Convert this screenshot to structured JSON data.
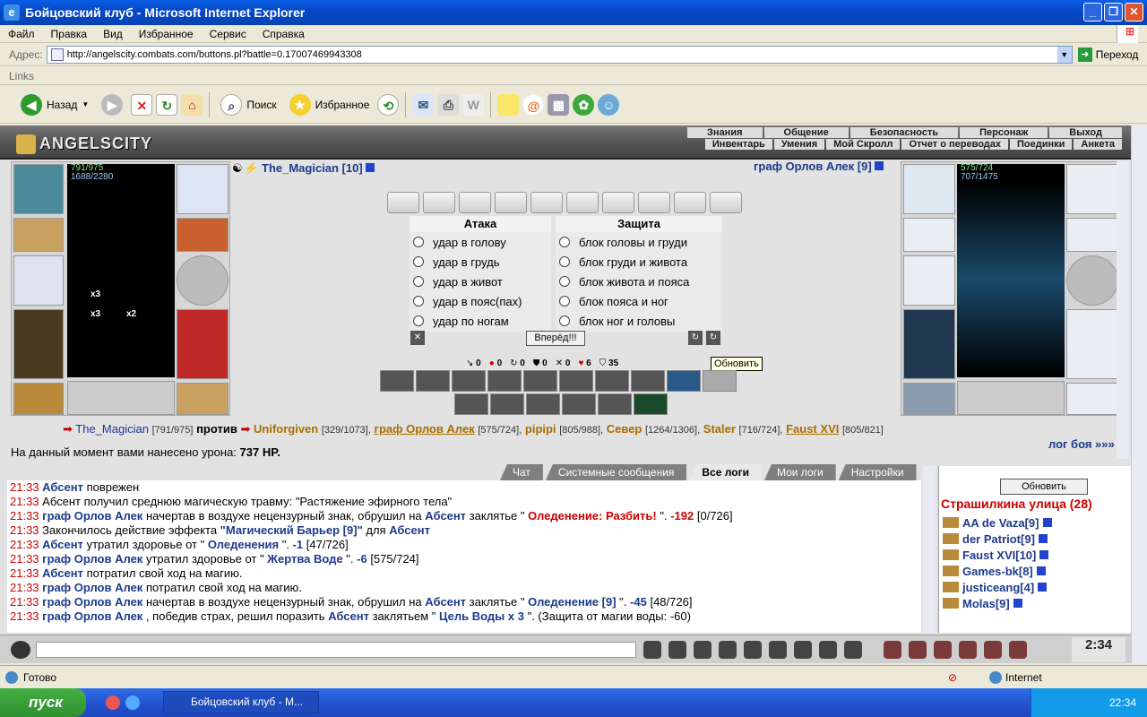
{
  "window": {
    "title": "Бойцовский клуб - Microsoft Internet Explorer"
  },
  "menu": [
    "Файл",
    "Правка",
    "Вид",
    "Избранное",
    "Сервис",
    "Справка"
  ],
  "address": {
    "label": "Адрес:",
    "url": "http://angelscity.combats.com/buttons.pl?battle=0.17007469943308",
    "go": "Переход"
  },
  "links": "Links",
  "toolbar": {
    "back": "Назад",
    "search": "Поиск",
    "favorites": "Избранное"
  },
  "site": {
    "logo": "ANGELSCITY",
    "menu_top": [
      "Знания",
      "Общение",
      "Безопасность",
      "Персонаж",
      "Выход"
    ],
    "menu_bottom": [
      "Инвентарь",
      "Умения",
      "Мой Скролл",
      "Отчет о переводах",
      "Поединки",
      "Анкета"
    ]
  },
  "player": {
    "name": "The_Magician [10]",
    "hp": "791/975",
    "mana": "1688/2280",
    "badges": [
      "x3",
      "x3",
      "x2"
    ]
  },
  "enemy": {
    "name": "граф Орлов Алек [9]",
    "hp": "575/724",
    "mana": "707/1475"
  },
  "attack": {
    "header": "Атака",
    "options": [
      "удар в голову",
      "удар в грудь",
      "удар в живот",
      "удар в пояс(пах)",
      "удар по ногам"
    ]
  },
  "defense": {
    "header": "Защита",
    "options": [
      "блок головы и груди",
      "блок груди и живота",
      "блок живота и пояса",
      "блок пояса и ног",
      "блок ног и головы"
    ]
  },
  "forward": "Вперёд!!!",
  "counters": [
    "0",
    "0",
    "0",
    "0",
    "0",
    "6",
    "35"
  ],
  "tooltip": "Обновить",
  "versus": {
    "p1": "The_Magician",
    "p1s": "[791/975]",
    "word": "против",
    "t1": "Uniforgiven",
    "t1s": "[329/1073],",
    "t2": "граф Орлов Алек",
    "t2s": "[575/724],",
    "t3": "pipipi",
    "t3s": "[805/988],",
    "t4": "Север",
    "t4s": "[1264/1306],",
    "t5": "Staler",
    "t5s": "[716/724],",
    "t6": "Faust XVI",
    "t6s": "[805/821]"
  },
  "damage": {
    "label": "На данный момент вами нанесено урона:",
    "value": "737 HP."
  },
  "fightlog": "лог боя »»»",
  "tabs": [
    "Чат",
    "Системные сообщения",
    "Все логи",
    "Мои логи",
    "Настройки"
  ],
  "chat": [
    {
      "t": "21:33",
      "parts": [
        [
          "n",
          "Абсент"
        ],
        [
          "",
          "поврежен"
        ]
      ]
    },
    {
      "t": "21:33",
      "parts": [
        [
          "",
          "Абсент получил среднюю магическую травму: \"Растяжение эфирного тела\""
        ]
      ]
    },
    {
      "t": "21:33",
      "parts": [
        [
          "n",
          "граф Орлов Алек"
        ],
        [
          "",
          "начертав в воздухе нецензурный знак, обрушил на"
        ],
        [
          "n",
          "Абсент"
        ],
        [
          "",
          "заклятье \""
        ],
        [
          "m",
          "Оледенение: Разбить!"
        ],
        [
          "",
          "\"."
        ],
        [
          "m",
          "-192"
        ],
        [
          "",
          "[0/726]"
        ]
      ]
    },
    {
      "t": "21:33",
      "parts": [
        [
          "",
          "Закончилось действие эффекта"
        ],
        [
          "q",
          "\"Магический Барьер [9]\""
        ],
        [
          "",
          "для"
        ],
        [
          "n",
          "Абсент"
        ]
      ]
    },
    {
      "t": "21:33",
      "parts": [
        [
          "n",
          "Абсент"
        ],
        [
          "",
          "утратил здоровье от \""
        ],
        [
          "q",
          "Оледенения"
        ],
        [
          "",
          "\"."
        ],
        [
          "q",
          "-1"
        ],
        [
          "",
          "[47/726]"
        ]
      ]
    },
    {
      "t": "21:33",
      "parts": [
        [
          "n",
          "граф Орлов Алек"
        ],
        [
          "",
          "утратил здоровье от \""
        ],
        [
          "q",
          "Жертва Воде"
        ],
        [
          "",
          "\"."
        ],
        [
          "q",
          "-6"
        ],
        [
          "",
          "[575/724]"
        ]
      ]
    },
    {
      "t": "21:33",
      "parts": [
        [
          "n",
          "Абсент"
        ],
        [
          "",
          "потратил свой ход на магию."
        ]
      ]
    },
    {
      "t": "21:33",
      "parts": [
        [
          "n",
          "граф Орлов Алек"
        ],
        [
          "",
          "потратил свой ход на магию."
        ]
      ]
    },
    {
      "t": "21:33",
      "parts": [
        [
          "n",
          "граф Орлов Алек"
        ],
        [
          "",
          "начертав в воздухе нецензурный знак, обрушил на"
        ],
        [
          "n",
          "Абсент"
        ],
        [
          "",
          "заклятье \""
        ],
        [
          "q",
          "Оледенение [9]"
        ],
        [
          "",
          "\"."
        ],
        [
          "q",
          "-45"
        ],
        [
          "",
          "[48/726]"
        ]
      ]
    },
    {
      "t": "21:33",
      "parts": [
        [
          "n",
          "граф Орлов Алек"
        ],
        [
          "",
          ", победив страх, решил поразить"
        ],
        [
          "n",
          "Абсент"
        ],
        [
          "",
          "заклятьем \""
        ],
        [
          "q",
          "Цель Воды x 3"
        ],
        [
          "",
          "\". (Защита от магии воды: -60)"
        ]
      ]
    }
  ],
  "who": {
    "refresh": "Обновить",
    "location": "Страшилкина улица (28)",
    "users": [
      "AA de Vaza[9]",
      "der Patriot[9]",
      "Faust XVI[10]",
      "Games-bk[8]",
      "justiceang[4]",
      "Molas[9]"
    ]
  },
  "clock": "2:34",
  "status": {
    "text": "Готово",
    "zone": "Internet"
  },
  "taskbar": {
    "start": "пуск",
    "task": "Бойцовский клуб - М...",
    "time": "22:34"
  }
}
